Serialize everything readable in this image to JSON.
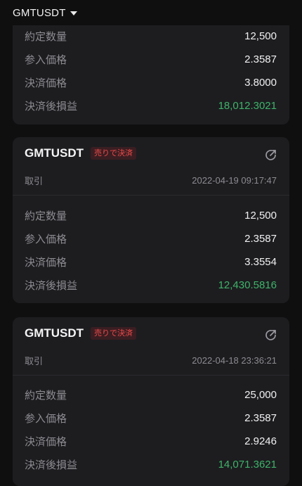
{
  "header": {
    "pair_label": "GMTUSDT"
  },
  "field_labels": {
    "quantity": "約定数量",
    "entry_price": "参入価格",
    "exit_price": "決済価格",
    "pnl": "決済後損益"
  },
  "cards": [
    {
      "quantity": "12,500",
      "entry_price": "2.3587",
      "exit_price": "3.8000",
      "pnl": "18,012.3021"
    },
    {
      "title": "GMTUSDT",
      "badge": "売りで決済",
      "type": "取引",
      "timestamp": "2022-04-19 09:17:47",
      "quantity": "12,500",
      "entry_price": "2.3587",
      "exit_price": "3.3554",
      "pnl": "12,430.5816"
    },
    {
      "title": "GMTUSDT",
      "badge": "売りで決済",
      "type": "取引",
      "timestamp": "2022-04-18 23:36:21",
      "quantity": "25,000",
      "entry_price": "2.3587",
      "exit_price": "2.9246",
      "pnl": "14,071.3621"
    }
  ],
  "colors": {
    "background": "#0f0f10",
    "card": "#1d1d20",
    "profit": "#3fb36a",
    "badge_text": "#ef4a4a",
    "badge_bg": "#3a1e22"
  },
  "icons": {
    "share": "share-icon",
    "dropdown": "chevron-down-icon"
  }
}
